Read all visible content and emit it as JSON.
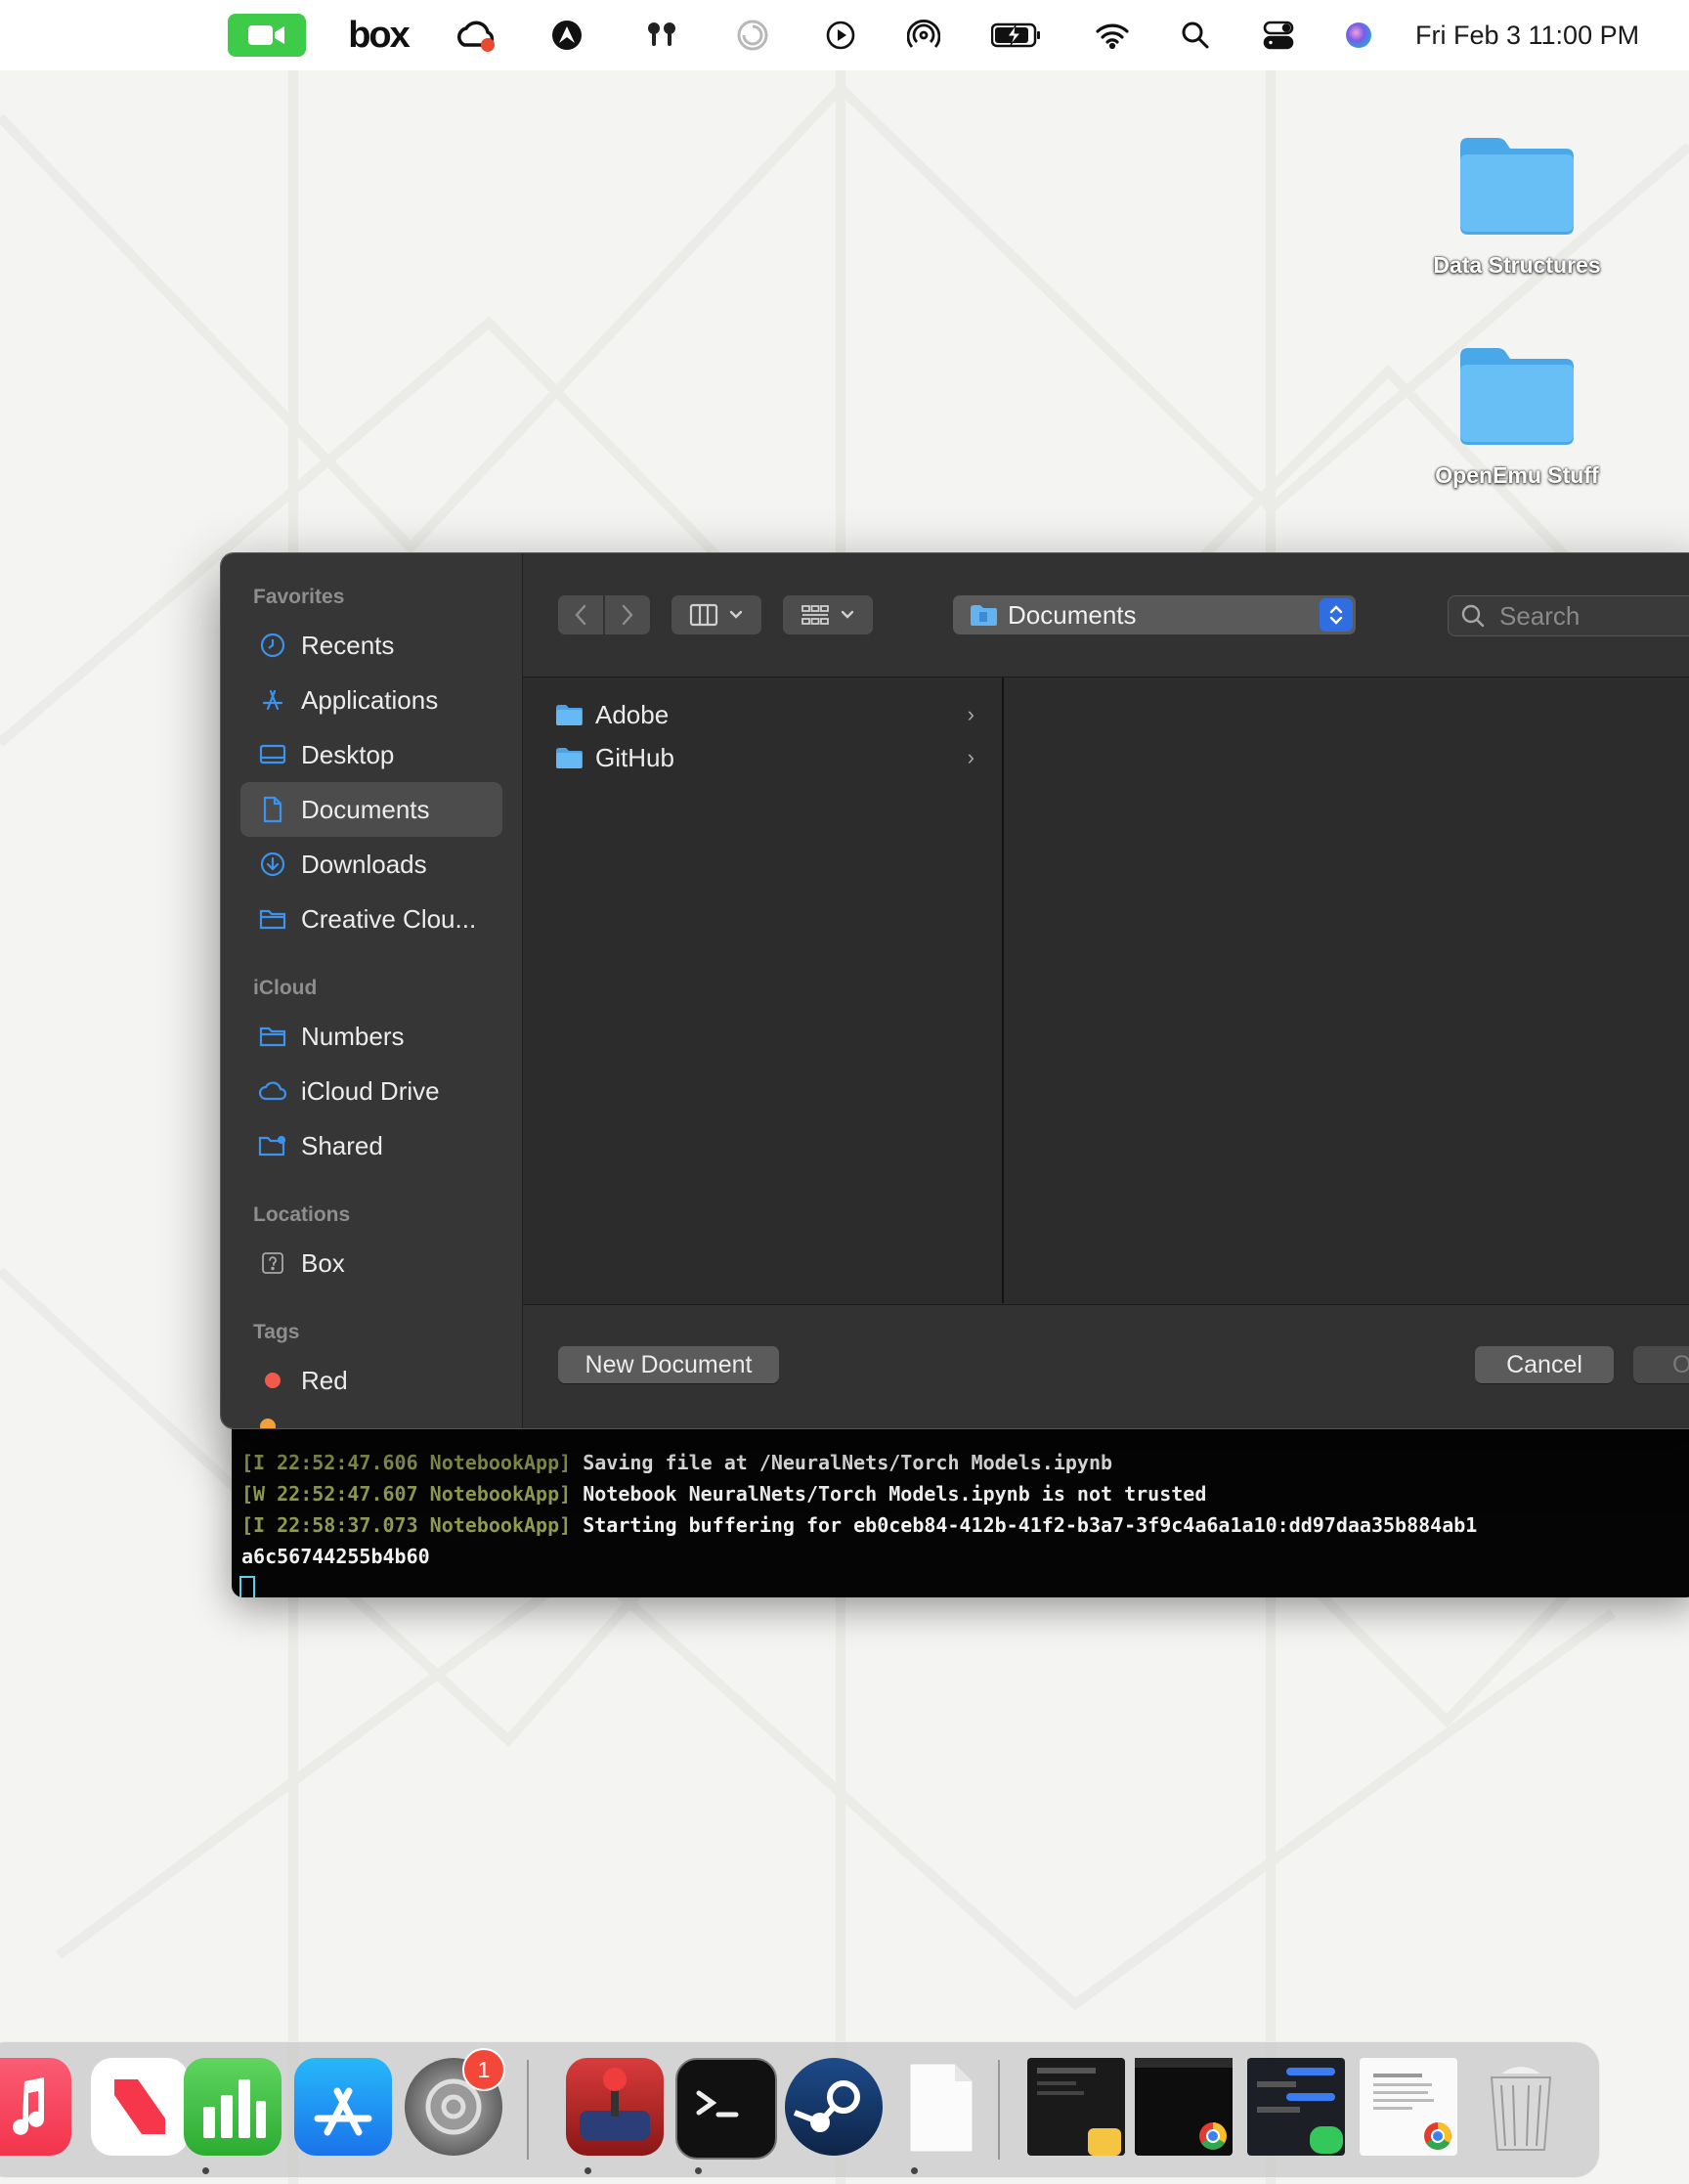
{
  "menubar": {
    "box_label": "box",
    "clock": "Fri Feb 3  11:00 PM",
    "icons": [
      "facetime-icon",
      "box-icon",
      "creative-cloud-icon",
      "vpn-icon",
      "airpods-icon",
      "focus-icon",
      "play-icon",
      "airdrop-icon",
      "battery-charging-icon",
      "wifi-icon",
      "spotlight-search-icon",
      "control-center-icon",
      "siri-icon"
    ]
  },
  "desktop": {
    "folders": [
      {
        "label": "Data Structures"
      },
      {
        "label": "OpenEmu Stuff"
      }
    ]
  },
  "dialog": {
    "sidebar": {
      "favorites_heading": "Favorites",
      "favorites": [
        {
          "label": "Recents",
          "icon": "clock-icon"
        },
        {
          "label": "Applications",
          "icon": "applications-icon"
        },
        {
          "label": "Desktop",
          "icon": "desktop-icon"
        },
        {
          "label": "Documents",
          "icon": "document-icon",
          "selected": true
        },
        {
          "label": "Downloads",
          "icon": "download-icon"
        },
        {
          "label": "Creative Clou...",
          "icon": "folder-icon"
        }
      ],
      "icloud_heading": "iCloud",
      "icloud": [
        {
          "label": "Numbers",
          "icon": "folder-icon"
        },
        {
          "label": "iCloud Drive",
          "icon": "cloud-icon"
        },
        {
          "label": "Shared",
          "icon": "shared-folder-icon"
        }
      ],
      "locations_heading": "Locations",
      "locations": [
        {
          "label": "Box",
          "icon": "box-drive-icon"
        }
      ],
      "tags_heading": "Tags",
      "tags": [
        {
          "label": "Red",
          "color": "#f15a4b"
        }
      ]
    },
    "toolbar": {
      "location": "Documents",
      "search_placeholder": "Search"
    },
    "files": [
      {
        "name": "Adobe"
      },
      {
        "name": "GitHub"
      }
    ],
    "buttons": {
      "new_document": "New Document",
      "cancel": "Cancel",
      "open": "Ope"
    }
  },
  "terminal": {
    "lines": [
      {
        "prefix": "[I 22:52:47.606 NotebookApp]",
        "text": " Saving file at /NeuralNets/Torch Models.ipynb"
      },
      {
        "prefix": "[W 22:52:47.607 NotebookApp]",
        "text": " Notebook NeuralNets/Torch Models.ipynb is not trusted"
      },
      {
        "prefix": "[I 22:58:37.073 NotebookApp]",
        "text": " Starting buffering for eb0ceb84-412b-41f2-b3a7-3f9c4a6a1a10:dd97daa35b884ab1"
      },
      {
        "prefix": "",
        "text": "a6c56744255b4b60"
      }
    ]
  },
  "dock": {
    "settings_badge": "1",
    "apps": [
      "music-icon",
      "news-icon",
      "numbers-icon",
      "app-store-icon",
      "system-settings-icon",
      "joystick-app-icon",
      "terminal-icon",
      "steam-icon",
      "blank-document-icon",
      "notes-window-icon",
      "chrome-window-icon",
      "messages-window-icon",
      "chrome-document-window-icon",
      "trash-icon"
    ]
  }
}
